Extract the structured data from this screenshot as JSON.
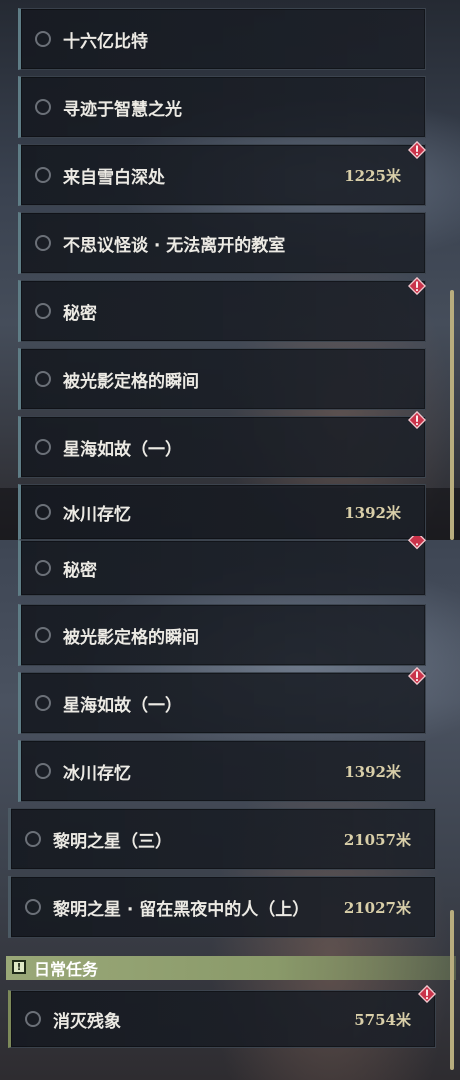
{
  "top_panel": {
    "quests": [
      {
        "title": "十六亿比特",
        "distance": "",
        "alert": false
      },
      {
        "title": "寻迹于智慧之光",
        "distance": "",
        "alert": false
      },
      {
        "title": "来自雪白深处",
        "distance": "1225米",
        "alert": true
      },
      {
        "title": "不思议怪谈 · 无法离开的教室",
        "distance": "",
        "alert": false
      },
      {
        "title": "秘密",
        "distance": "",
        "alert": true
      },
      {
        "title": "被光影定格的瞬间",
        "distance": "",
        "alert": false
      },
      {
        "title": "星海如故（一）",
        "distance": "",
        "alert": true
      },
      {
        "title": "冰川存忆",
        "distance": "1392米",
        "alert": false
      }
    ]
  },
  "bottom_panel": {
    "quests": [
      {
        "title": "秘密",
        "distance": "",
        "alert": true
      },
      {
        "title": "被光影定格的瞬间",
        "distance": "",
        "alert": false
      },
      {
        "title": "星海如故（一）",
        "distance": "",
        "alert": true
      },
      {
        "title": "冰川存忆",
        "distance": "1392米",
        "alert": false
      },
      {
        "title": "黎明之星（三）",
        "distance": "21057米",
        "alert": false
      },
      {
        "title": "黎明之星 · 留在黑夜中的人（上）",
        "distance": "21027米",
        "alert": false
      }
    ],
    "daily_section": {
      "icon_glyph": "!",
      "label": "日常任务",
      "quests": [
        {
          "title": "消灭残象",
          "distance": "5754米",
          "alert": true
        }
      ]
    }
  },
  "colors": {
    "accent_border": "#5f7d86",
    "distance_text": "#d9cfa9",
    "alert_red": "#c9334a",
    "section_green": "#9aa878"
  }
}
